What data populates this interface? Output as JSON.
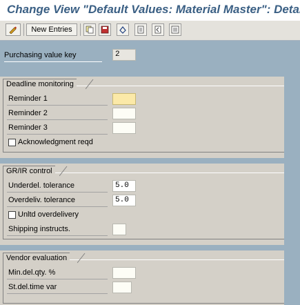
{
  "title": "Change View \"Default Values: Material Master\": Details",
  "toolbar": {
    "new_entries_label": "New Entries",
    "icons": [
      "glasses-pencil-icon",
      "copy-icon",
      "save-icon",
      "undo-icon",
      "first-page-icon",
      "previous-page-icon",
      "next-page-icon"
    ]
  },
  "purchasing_value_key": {
    "label": "Purchasing value key",
    "value": "2"
  },
  "deadline_monitoring": {
    "title": "Deadline monitoring",
    "reminder1": {
      "label": "Reminder 1",
      "value": ""
    },
    "reminder2": {
      "label": "Reminder 2",
      "value": ""
    },
    "reminder3": {
      "label": "Reminder 3",
      "value": ""
    },
    "ack_label": "Acknowledgment reqd",
    "ack_checked": false
  },
  "grir_control": {
    "title": "GR/IR control",
    "underdel": {
      "label": "Underdel. tolerance",
      "value": "5.0"
    },
    "overdeliv": {
      "label": "Overdeliv. tolerance",
      "value": "5.0"
    },
    "unltd_label": "Unltd overdelivery",
    "unltd_checked": false,
    "shipping": {
      "label": "Shipping instructs.",
      "value": ""
    }
  },
  "vendor_evaluation": {
    "title": "Vendor evaluation",
    "mindel": {
      "label": "Min.del.qty. %",
      "value": ""
    },
    "stdel": {
      "label": "St.del.time var",
      "value": ""
    }
  },
  "colors": {
    "title": "#3a5f84",
    "header_band": "#9ab0c0",
    "background": "#d4d0c8",
    "focus_field": "#fbe9a8"
  }
}
